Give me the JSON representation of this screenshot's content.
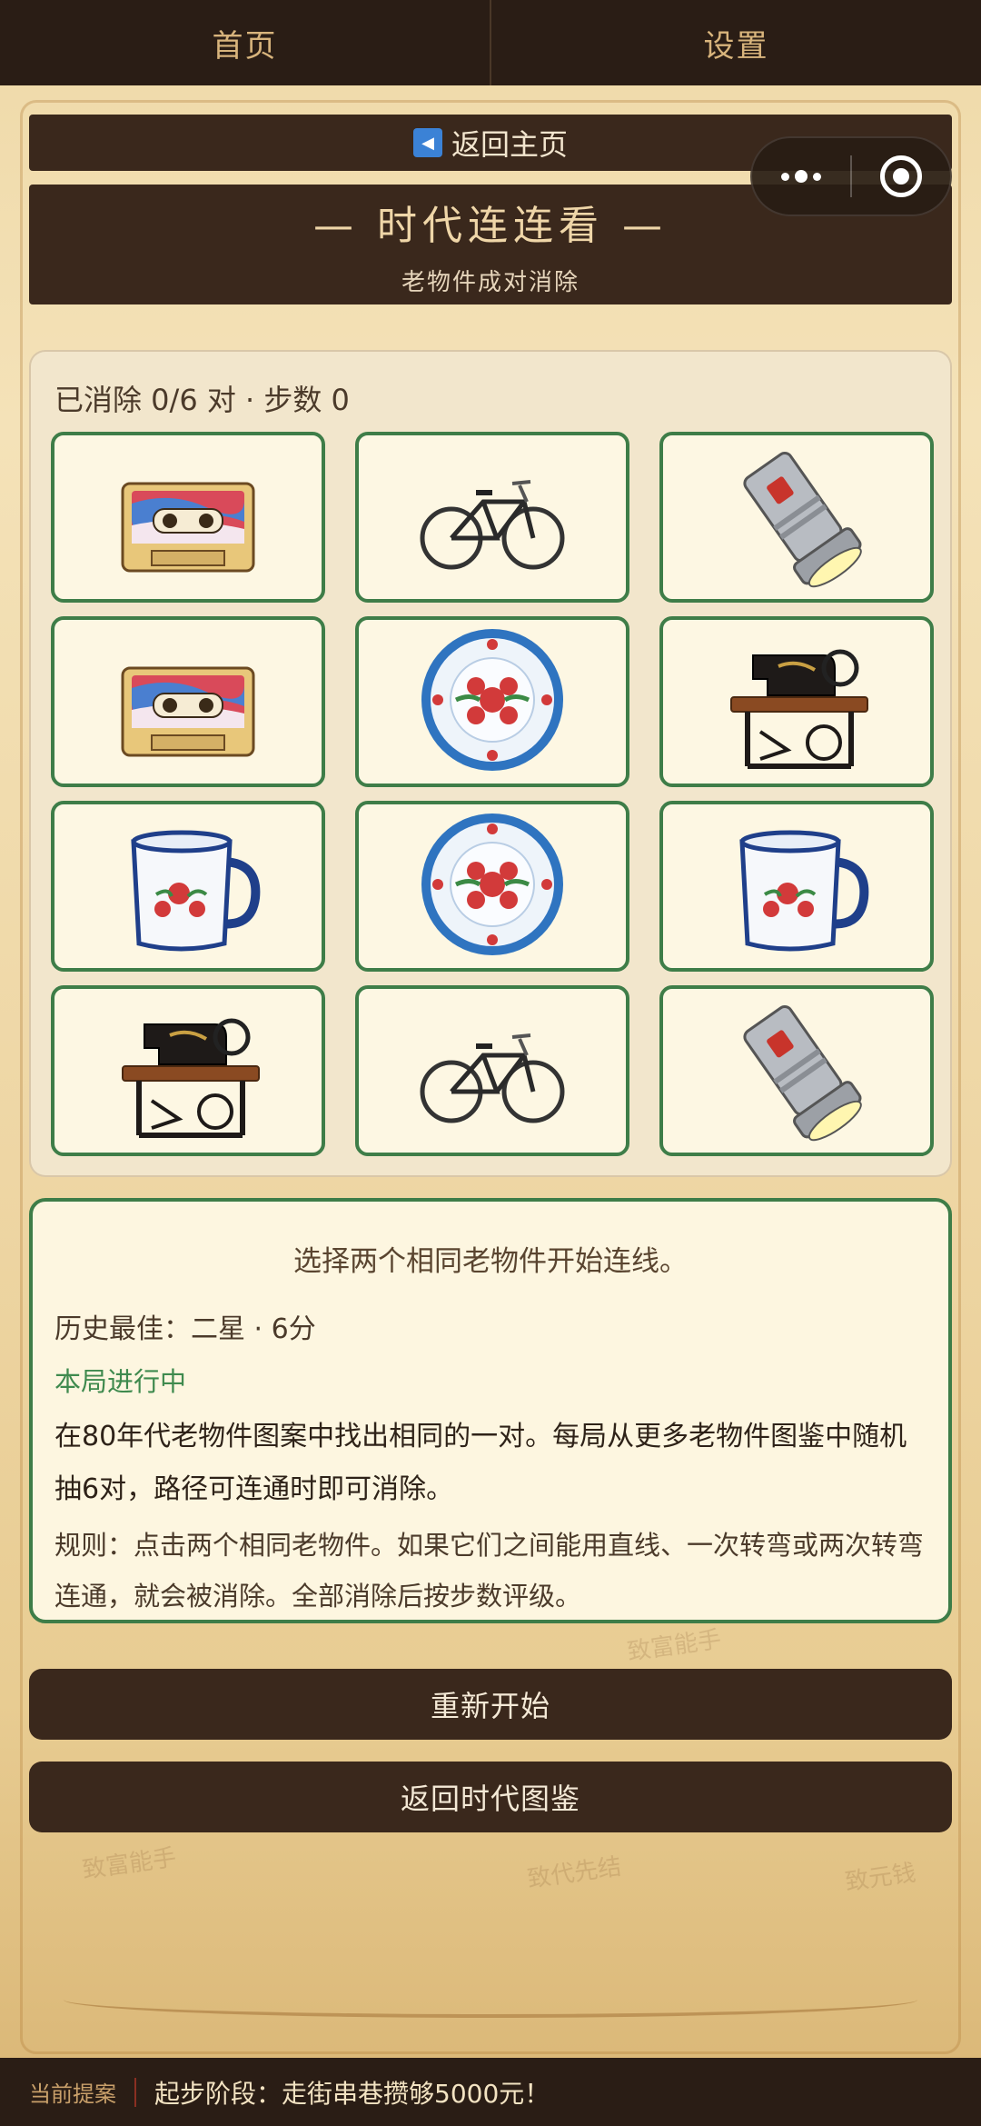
{
  "topbar": {
    "tabs": [
      {
        "label": "首页"
      },
      {
        "label": "设置"
      }
    ]
  },
  "back": {
    "label": "返回主页",
    "icon": "back-triangle-icon"
  },
  "banner": {
    "title": "— 时代连连看 —",
    "subtitle": "老物件成对消除"
  },
  "board": {
    "stats": "已消除 0/6 对 · 步数 0",
    "tiles": [
      {
        "item": "cassette"
      },
      {
        "item": "bicycle"
      },
      {
        "item": "flashlight"
      },
      {
        "item": "cassette"
      },
      {
        "item": "plate"
      },
      {
        "item": "sewing-machine"
      },
      {
        "item": "mug"
      },
      {
        "item": "plate"
      },
      {
        "item": "mug"
      },
      {
        "item": "sewing-machine"
      },
      {
        "item": "bicycle"
      },
      {
        "item": "flashlight"
      }
    ]
  },
  "info": {
    "prompt": "选择两个相同老物件开始连线。",
    "best": "历史最佳：二星 · 6分",
    "state": "本局进行中",
    "description": "在80年代老物件图案中找出相同的一对。每局从更多老物件图鉴中随机抽6对，路径可连通时即可消除。",
    "rules": "规则：点击两个相同老物件。如果它们之间能用直线、一次转弯或两次转弯连通，就会被消除。全部消除后按步数评级。"
  },
  "buttons": {
    "restart": "重新开始",
    "back_atlas": "返回时代图鉴"
  },
  "watermarks": [
    "致富能手",
    "致富能手",
    "致代先结",
    "致元钱"
  ],
  "ticker": {
    "label": "当前提案",
    "text": "起步阶段：走街串巷攒够5000元！"
  },
  "colors": {
    "dark": "#3a281c",
    "tile_border": "#3e7d48",
    "accent_gold": "#efd6a8"
  }
}
